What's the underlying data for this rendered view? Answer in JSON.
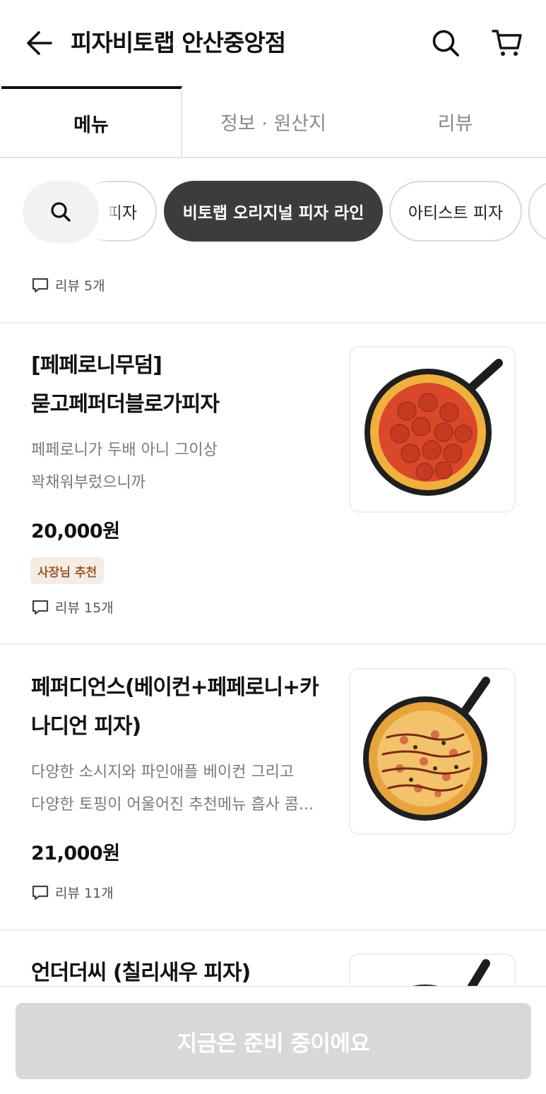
{
  "header": {
    "store_name": "피자비토랩 안산중앙점",
    "back_icon": "arrow-left-icon",
    "search_icon": "search-icon",
    "cart_icon": "cart-icon"
  },
  "tabs": [
    {
      "label": "메뉴",
      "active": true
    },
    {
      "label": "정보 · 원산지",
      "active": false
    },
    {
      "label": "리뷰",
      "active": false
    }
  ],
  "categories": {
    "partial_label": "피자",
    "active_label": "비토랩 오리지널 피자 라인",
    "next_label": "아티스트 피자"
  },
  "previous_item": {
    "review_text": "리뷰 5개"
  },
  "menu_items": [
    {
      "name_line1": "[페페로니무덤]",
      "name_line2": "묻고페퍼더블로가피자",
      "desc_line1": "페페로니가 두배 아니 그이상",
      "desc_line2": "꽉채워부렀으니까",
      "price": "20,000원",
      "badge": "사장님 추천",
      "review_text": "리뷰 15개"
    },
    {
      "name_line1": "페퍼디언스(베이컨+페페로니+카",
      "name_line2": "나디언 피자)",
      "desc_line1": "다양한 소시지와 파인애플 베이컨 그리고",
      "desc_line2": "다양한 토핑이 어울어진 추천메뉴 흡사 콤...",
      "price": "21,000원",
      "review_text": "리뷰 11개"
    },
    {
      "name_line1": "언더더씨 (칠리새우 피자)"
    }
  ],
  "bottom": {
    "order_label": "지금은 준비 중이에요"
  },
  "colors": {
    "chip_active_bg": "#3c3c3c",
    "badge_bg": "#f5ede4",
    "badge_text": "#9a5a2c",
    "disabled_button": "#d8d8d8"
  }
}
